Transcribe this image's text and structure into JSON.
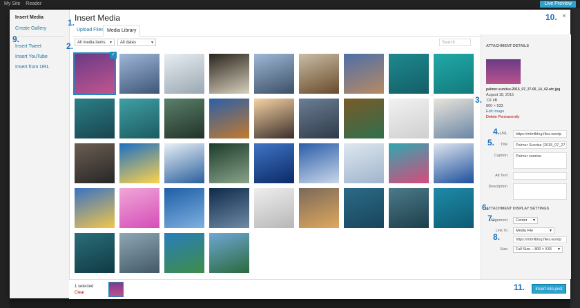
{
  "admin_bar": {
    "site": "My Site",
    "reader": "Reader",
    "preview": "Live Preview"
  },
  "frame": {
    "title": "Insert Media",
    "close_icon": "×"
  },
  "menu": {
    "items": [
      {
        "label": "Insert Media",
        "active": true
      },
      {
        "label": "Create Gallery"
      },
      {
        "label": "Insert Tweet"
      },
      {
        "label": "Insert YouTube"
      },
      {
        "label": "Insert from URL"
      }
    ]
  },
  "tabs": [
    {
      "label": "Upload Files"
    },
    {
      "label": "Media Library"
    }
  ],
  "filters": {
    "type": "All media items",
    "date": "All dates",
    "search_placeholder": "Search"
  },
  "thumbnails": [
    {
      "colors": [
        "#6a3a86",
        "#c25590"
      ],
      "selected": true
    },
    {
      "colors": [
        "#9fb6d8",
        "#3d5577"
      ]
    },
    {
      "colors": [
        "#e8eef2",
        "#9aa7b1"
      ]
    },
    {
      "colors": [
        "#2a241c",
        "#d7d0bd"
      ]
    },
    {
      "colors": [
        "#9fb8d6",
        "#3b4f66"
      ]
    },
    {
      "colors": [
        "#c8bda6",
        "#6a4a2a"
      ]
    },
    {
      "colors": [
        "#4d6fa8",
        "#b88a63"
      ]
    },
    {
      "colors": [
        "#1c8a8f",
        "#145e66"
      ]
    },
    {
      "colors": [
        "#20a9a6",
        "#137a7e"
      ]
    },
    {
      "colors": [
        "#2d7f86",
        "#17454f"
      ]
    },
    {
      "colors": [
        "#3fa0a3",
        "#1c5a62"
      ]
    },
    {
      "colors": [
        "#5b7f6a",
        "#213328"
      ]
    },
    {
      "colors": [
        "#2b5fa9",
        "#c37a2d"
      ]
    },
    {
      "colors": [
        "#f6d3a3",
        "#3a2e2a"
      ]
    },
    {
      "colors": [
        "#6b7e94",
        "#2e3a48"
      ]
    },
    {
      "colors": [
        "#7a5a2a",
        "#2f6f4c"
      ]
    },
    {
      "colors": [
        "#f2f2f2",
        "#cfcfcf"
      ]
    },
    {
      "colors": [
        "#e9e4da",
        "#6a86a6"
      ]
    },
    {
      "colors": [
        "#6c5e52",
        "#262626"
      ]
    },
    {
      "colors": [
        "#1b6fc4",
        "#ffd34a"
      ]
    },
    {
      "colors": [
        "#e9f0f6",
        "#2a5f9c"
      ]
    },
    {
      "colors": [
        "#1b3b2a",
        "#8aa38a"
      ]
    },
    {
      "colors": [
        "#3f74c4",
        "#0b2a66"
      ]
    },
    {
      "colors": [
        "#2a5da8",
        "#c9d7ea"
      ]
    },
    {
      "colors": [
        "#dfe7f0",
        "#9fb4cc"
      ]
    },
    {
      "colors": [
        "#30a7b1",
        "#d74a7a"
      ]
    },
    {
      "colors": [
        "#dfe6ef",
        "#1c4f9c"
      ]
    },
    {
      "colors": [
        "#3a72c4",
        "#f1c64a"
      ]
    },
    {
      "colors": [
        "#f0a6d8",
        "#d54db8"
      ]
    },
    {
      "colors": [
        "#1e5fa6",
        "#7fb0e0"
      ]
    },
    {
      "colors": [
        "#0e2a4a",
        "#6f8aa6"
      ]
    },
    {
      "colors": [
        "#eeeeee",
        "#b7b7b7"
      ]
    },
    {
      "colors": [
        "#7a6a5a",
        "#e0a85e"
      ]
    },
    {
      "colors": [
        "#2c6a86",
        "#18455c"
      ]
    },
    {
      "colors": [
        "#4c7a8a",
        "#1d3e4a"
      ]
    },
    {
      "colors": [
        "#1e8aa8",
        "#0e5b73"
      ]
    },
    {
      "colors": [
        "#2b6e7a",
        "#0f3a44"
      ]
    },
    {
      "colors": [
        "#8fa8b4",
        "#425868"
      ]
    },
    {
      "colors": [
        "#2a7ebc",
        "#3d8c48"
      ]
    },
    {
      "colors": [
        "#6fa7d6",
        "#2b6a3c"
      ]
    }
  ],
  "footer": {
    "selected_text": "1 selected",
    "clear": "Clear",
    "insert_button": "Insert into post"
  },
  "details": {
    "heading": "ATTACHMENT DETAILS",
    "filename": "palmer-sunrise-2015_07_27-05_14_42-utc.jpg",
    "date": "August 18, 2015",
    "size": "111 kB",
    "dimensions": "800 × 533",
    "edit_link": "Edit Image",
    "delete_link": "Delete Permanently",
    "url_label": "URL",
    "url_value": "https://mlmlblog.files.wordp",
    "title_label": "Title",
    "title_value": "Palmer Sunrise (2015_07_27",
    "caption_label": "Caption",
    "caption_value": "Palmer sunrise.",
    "alt_label": "Alt Text",
    "alt_value": "",
    "desc_label": "Description",
    "desc_value": ""
  },
  "display_settings": {
    "heading": "ATTACHMENT DISPLAY SETTINGS",
    "alignment_label": "Alignment",
    "alignment_value": "Center",
    "link_label": "Link To",
    "link_value": "Media File",
    "link_url": "https://mlmlblog.files.wordp",
    "size_label": "Size",
    "size_value": "Full Size – 800 × 533"
  },
  "annotations": [
    "1.",
    "2.",
    "3.",
    "4.",
    "5.",
    "6.",
    "7.",
    "8.",
    "9.",
    "10.",
    "11."
  ]
}
